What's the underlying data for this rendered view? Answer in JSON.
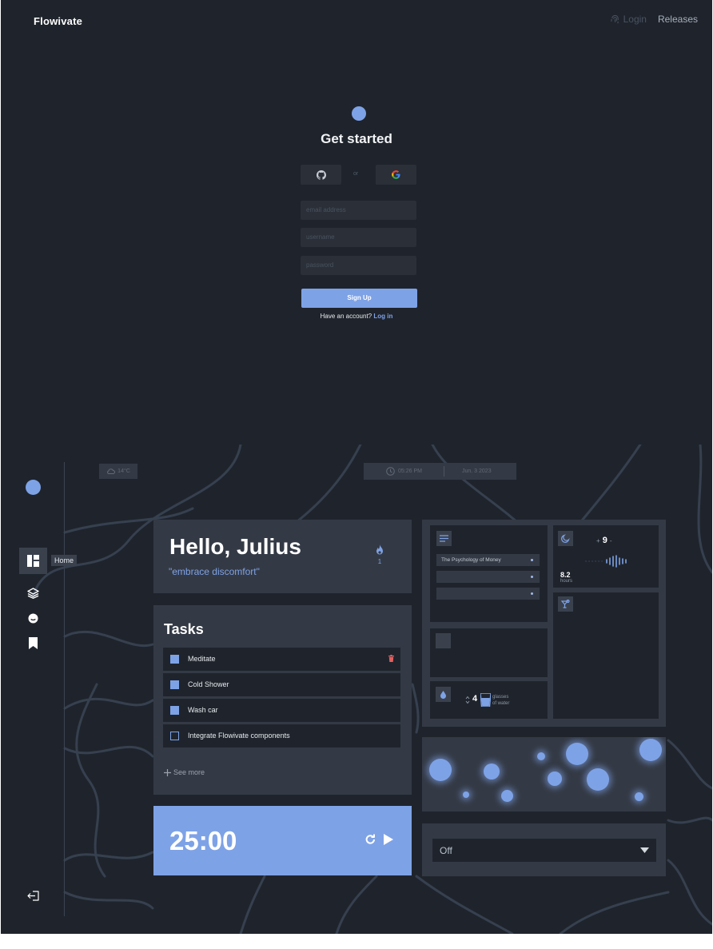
{
  "nav": {
    "brand": "Flowivate",
    "login": "Login",
    "releases": "Releases"
  },
  "signup": {
    "title": "Get started",
    "or": "or",
    "email_placeholder": "email address",
    "username_placeholder": "username",
    "password_placeholder": "password",
    "submit": "Sign Up",
    "have_account": "Have an account?",
    "login_link": "Log in"
  },
  "sidebar": {
    "home_tooltip": "Home"
  },
  "status": {
    "temperature": "14°C",
    "time": "05:26 PM",
    "date": "Jun. 3 2023"
  },
  "hello": {
    "greeting": "Hello, Julius",
    "quote": "\"embrace discomfort\"",
    "streak": "1"
  },
  "tasks": {
    "title": "Tasks",
    "items": [
      {
        "label": "Meditate",
        "done": true
      },
      {
        "label": "Cold Shower",
        "done": true
      },
      {
        "label": "Wash car",
        "done": true
      },
      {
        "label": "Integrate Flowivate components",
        "done": false
      }
    ],
    "see_more": "See more"
  },
  "timer": {
    "time": "25:00"
  },
  "books": {
    "items": [
      "The Psychology of Money",
      "",
      ""
    ]
  },
  "sleep": {
    "goal": "9",
    "minus": "-",
    "plus": "+",
    "hours_value": "8.2",
    "hours_label": "hours"
  },
  "water": {
    "count": "4",
    "label_line1": "glasses",
    "label_line2": "of water"
  },
  "sound": {
    "selected": "Off"
  },
  "colors": {
    "accent": "#7ea2e6",
    "background": "#1f242c",
    "card": "#343a45",
    "danger": "#e0605f"
  }
}
